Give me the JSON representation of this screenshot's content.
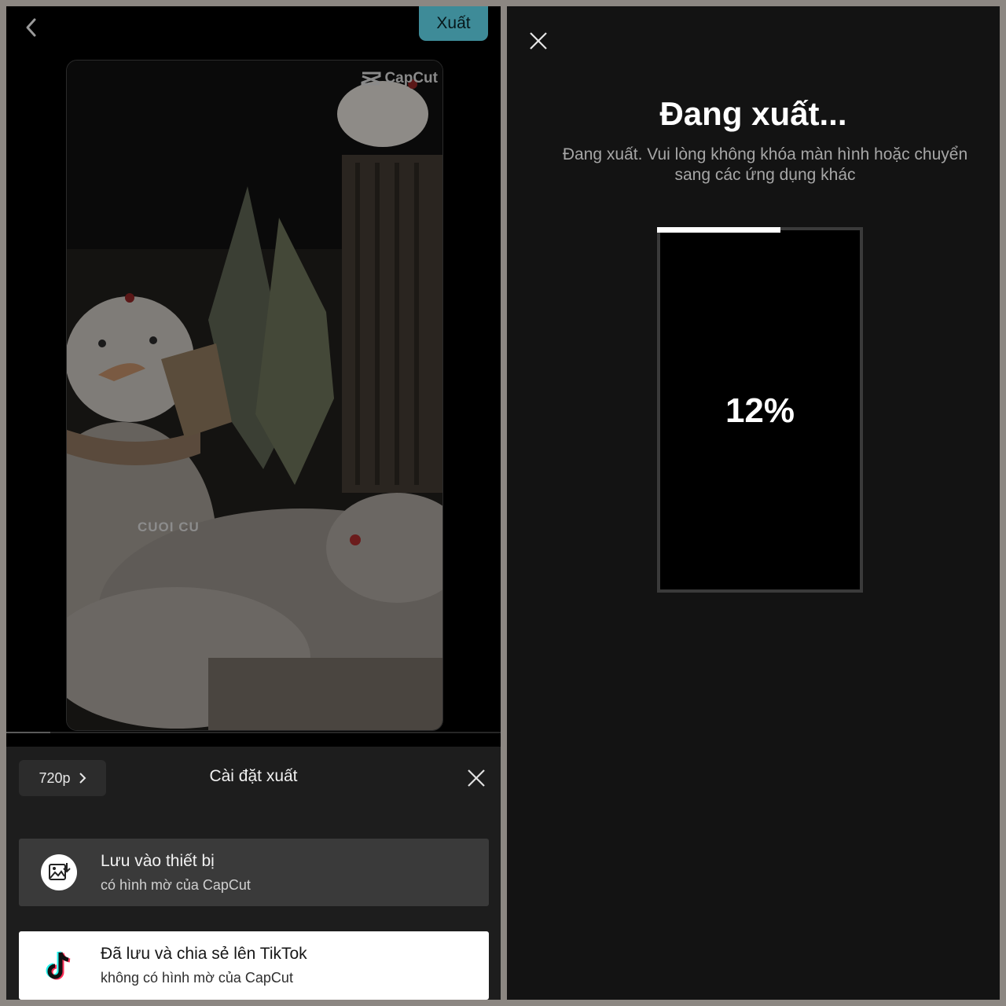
{
  "editor": {
    "export_label": "Xuất",
    "watermark_text": "CapCut",
    "overlay_text": "CUOI CU"
  },
  "export_settings": {
    "resolution": "720p",
    "title": "Cài đặt xuất",
    "options": [
      {
        "title": "Lưu vào thiết bị",
        "subtitle": "có hình mờ của CapCut"
      },
      {
        "title": "Đã lưu và chia sẻ lên TikTok",
        "subtitle": "không có hình mờ của CapCut"
      }
    ]
  },
  "exporting": {
    "title": "Đang xuất...",
    "description_line1": "Đang xuất. Vui lòng không khóa màn hình hoặc chuyển",
    "description_line2": "sang các ứng dụng khác",
    "progress_label": "12%",
    "progress_fraction": 0.6
  },
  "colors": {
    "accent": "#3e8b98",
    "background_dark": "#131313",
    "sheet": "#1d1d1d"
  },
  "icons": [
    "chevron-left-icon",
    "close-icon",
    "chevron-right-icon",
    "save-image-icon",
    "tiktok-icon",
    "capcut-logo-icon"
  ]
}
